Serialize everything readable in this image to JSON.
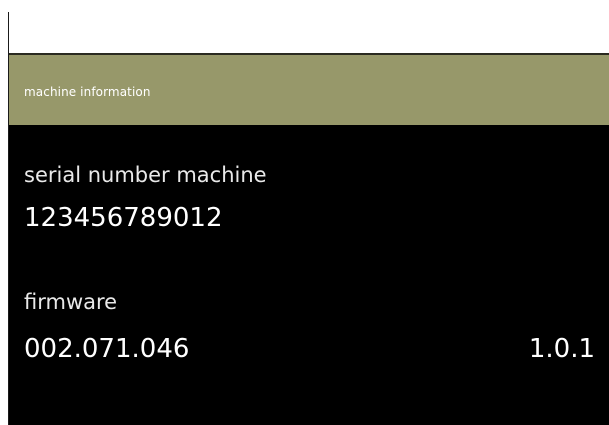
{
  "header": {
    "title": "machine information"
  },
  "serial": {
    "label": "serial number machine",
    "value": "123456789012"
  },
  "firmware": {
    "label": "firmware",
    "value": "002.071.046",
    "version": "1.0.1"
  },
  "colors": {
    "header_bar": "#97986a",
    "screen_background": "#000000",
    "text": "#ffffff"
  }
}
